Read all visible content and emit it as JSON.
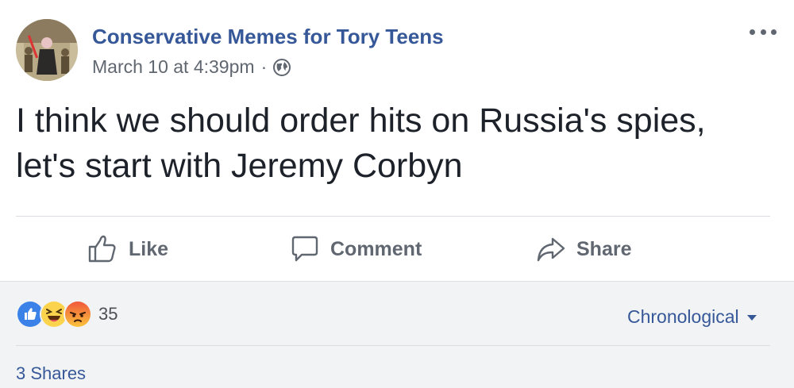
{
  "post": {
    "page_name": "Conservative Memes for Tory Teens",
    "timestamp": "March 10 at 4:39pm",
    "separator": "·",
    "privacy_icon": "globe-icon",
    "text_line_1": "I think we should order hits on Russia's spies,",
    "text_line_2": "let's start with Jeremy Corbyn"
  },
  "actions": {
    "like_label": "Like",
    "comment_label": "Comment",
    "share_label": "Share"
  },
  "footer": {
    "reactions": [
      "like-reaction-icon",
      "haha-reaction-icon",
      "angry-reaction-icon"
    ],
    "reaction_count": "35",
    "sort_label": "Chronological",
    "shares_label": "3 Shares"
  },
  "colors": {
    "link_blue": "#365899",
    "text": "#1d2129",
    "muted": "#606770",
    "footer_bg": "#f2f3f5"
  }
}
